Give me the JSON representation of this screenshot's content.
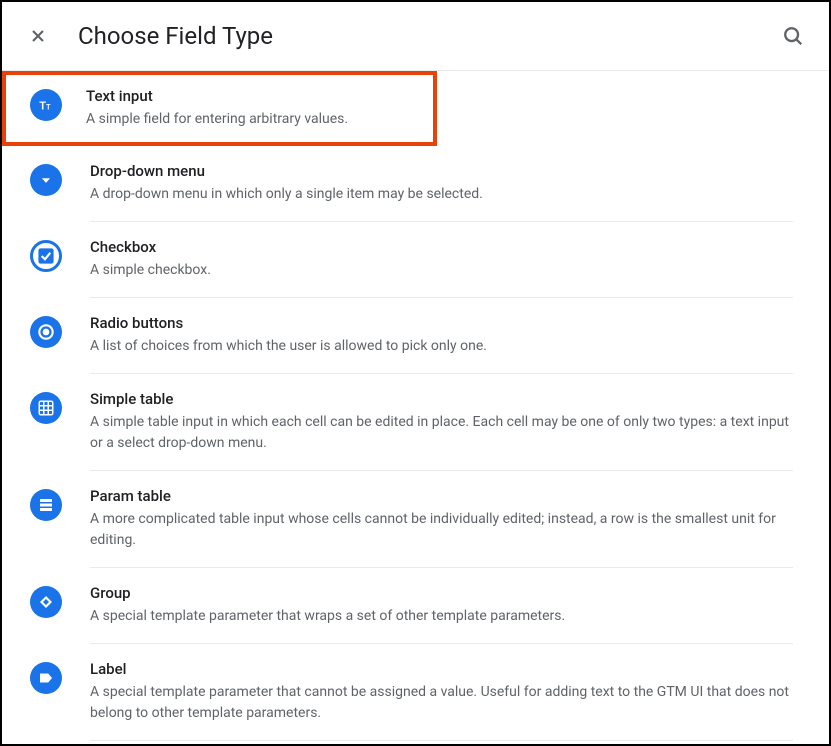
{
  "header": {
    "title": "Choose Field Type"
  },
  "items": [
    {
      "icon": "text",
      "title": "Text input",
      "desc": "A simple field for entering arbitrary values.",
      "highlighted": true
    },
    {
      "icon": "dropdown",
      "title": "Drop-down menu",
      "desc": "A drop-down menu in which only a single item may be selected."
    },
    {
      "icon": "checkbox",
      "title": "Checkbox",
      "desc": "A simple checkbox."
    },
    {
      "icon": "radio",
      "title": "Radio buttons",
      "desc": "A list of choices from which the user is allowed to pick only one."
    },
    {
      "icon": "table",
      "title": "Simple table",
      "desc": "A simple table input in which each cell can be edited in place. Each cell may be one of only two types: a text input or a select drop-down menu."
    },
    {
      "icon": "paramtable",
      "title": "Param table",
      "desc": "A more complicated table input whose cells cannot be individually edited; instead, a row is the smallest unit for editing."
    },
    {
      "icon": "group",
      "title": "Group",
      "desc": "A special template parameter that wraps a set of other template parameters."
    },
    {
      "icon": "label",
      "title": "Label",
      "desc": "A special template parameter that cannot be assigned a value. Useful for adding text to the GTM UI that does not belong to other template parameters."
    }
  ]
}
